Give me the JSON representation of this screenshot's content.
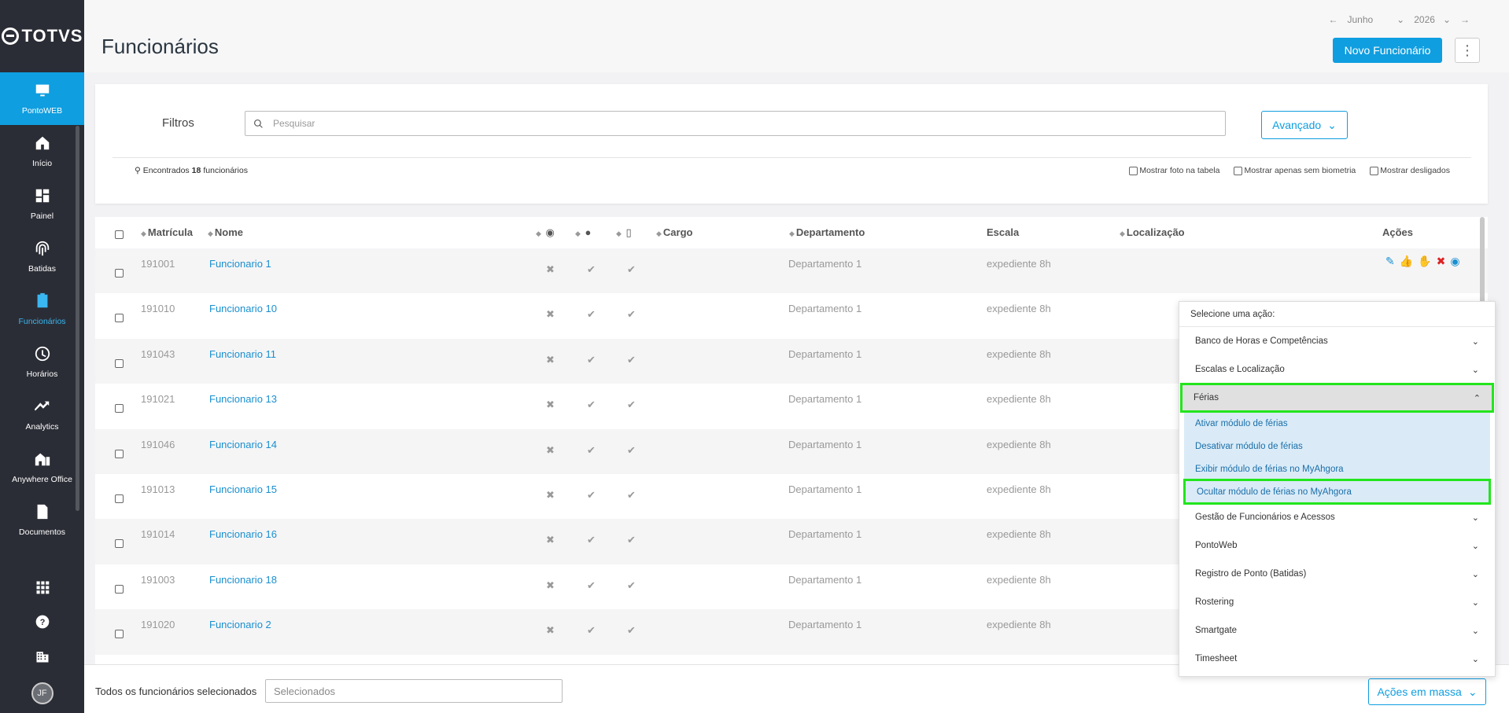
{
  "brand": "TOTVS",
  "sidebar": {
    "items": [
      {
        "label": "PontoWEB",
        "icon": "monitor-icon",
        "state": "active"
      },
      {
        "label": "Início",
        "icon": "home-icon",
        "state": ""
      },
      {
        "label": "Painel",
        "icon": "dashboard-icon",
        "state": ""
      },
      {
        "label": "Batidas",
        "icon": "fingerprint-icon",
        "state": ""
      },
      {
        "label": "Funcionários",
        "icon": "badge-icon",
        "state": "current"
      },
      {
        "label": "Horários",
        "icon": "clock-icon",
        "state": ""
      },
      {
        "label": "Analytics",
        "icon": "trend-icon",
        "state": ""
      },
      {
        "label": "Anywhere Office",
        "icon": "building-icon",
        "state": ""
      },
      {
        "label": "Documentos",
        "icon": "document-icon",
        "state": ""
      }
    ],
    "avatar": "JF"
  },
  "header": {
    "title": "Funcionários",
    "month": "Junho",
    "year": "2026",
    "new_button": "Novo Funcionário"
  },
  "filters": {
    "label": "Filtros",
    "search_placeholder": "Pesquisar",
    "advanced": "Avançado",
    "found_prefix": "Encontrados",
    "found_count": "18",
    "found_suffix": "funcionários",
    "show_photo": "Mostrar foto na tabela",
    "show_no_bio": "Mostrar apenas sem biometria",
    "show_off": "Mostrar desligados"
  },
  "table": {
    "headers": {
      "matricula": "Matrícula",
      "nome": "Nome",
      "cargo": "Cargo",
      "departamento": "Departamento",
      "escala": "Escala",
      "localizacao": "Localização",
      "acoes": "Ações"
    },
    "rows": [
      {
        "matricula": "191001",
        "nome": "Funcionario 1",
        "departamento": "Departamento 1",
        "escala": "expediente 8h"
      },
      {
        "matricula": "191010",
        "nome": "Funcionario 10",
        "departamento": "Departamento 1",
        "escala": "expediente 8h"
      },
      {
        "matricula": "191043",
        "nome": "Funcionario 11",
        "departamento": "Departamento 1",
        "escala": "expediente 8h"
      },
      {
        "matricula": "191021",
        "nome": "Funcionario 13",
        "departamento": "Departamento 1",
        "escala": "expediente 8h"
      },
      {
        "matricula": "191046",
        "nome": "Funcionario 14",
        "departamento": "Departamento 1",
        "escala": "expediente 8h"
      },
      {
        "matricula": "191013",
        "nome": "Funcionario 15",
        "departamento": "Departamento 1",
        "escala": "expediente 8h"
      },
      {
        "matricula": "191014",
        "nome": "Funcionario 16",
        "departamento": "Departamento 1",
        "escala": "expediente 8h"
      },
      {
        "matricula": "191003",
        "nome": "Funcionario 18",
        "departamento": "Departamento 1",
        "escala": "expediente 8h"
      },
      {
        "matricula": "191020",
        "nome": "Funcionario 2",
        "departamento": "Departamento 1",
        "escala": "expediente 8h"
      }
    ]
  },
  "footer": {
    "label": "Todos os funcionários selecionados",
    "input_placeholder": "Selecionados",
    "mass_button": "Ações em massa"
  },
  "dropdown": {
    "title": "Selecione uma ação:",
    "groups_before": [
      "Banco de Horas e Competências",
      "Escalas e Localização"
    ],
    "open_group": "Férias",
    "sub_items": [
      "Ativar módulo de férias",
      "Desativar módulo de férias",
      "Exibir módulo de férias no MyAhgora",
      "Ocultar módulo de férias no MyAhgora"
    ],
    "groups_after": [
      "Gestão de Funcionários e Acessos",
      "PontoWeb",
      "Registro de Ponto (Batidas)",
      "Rostering",
      "Smartgate",
      "Timesheet"
    ]
  },
  "colors": {
    "accent": "#0f9ee0",
    "sidebar": "#2b2d36",
    "highlight": "#22e51d"
  }
}
